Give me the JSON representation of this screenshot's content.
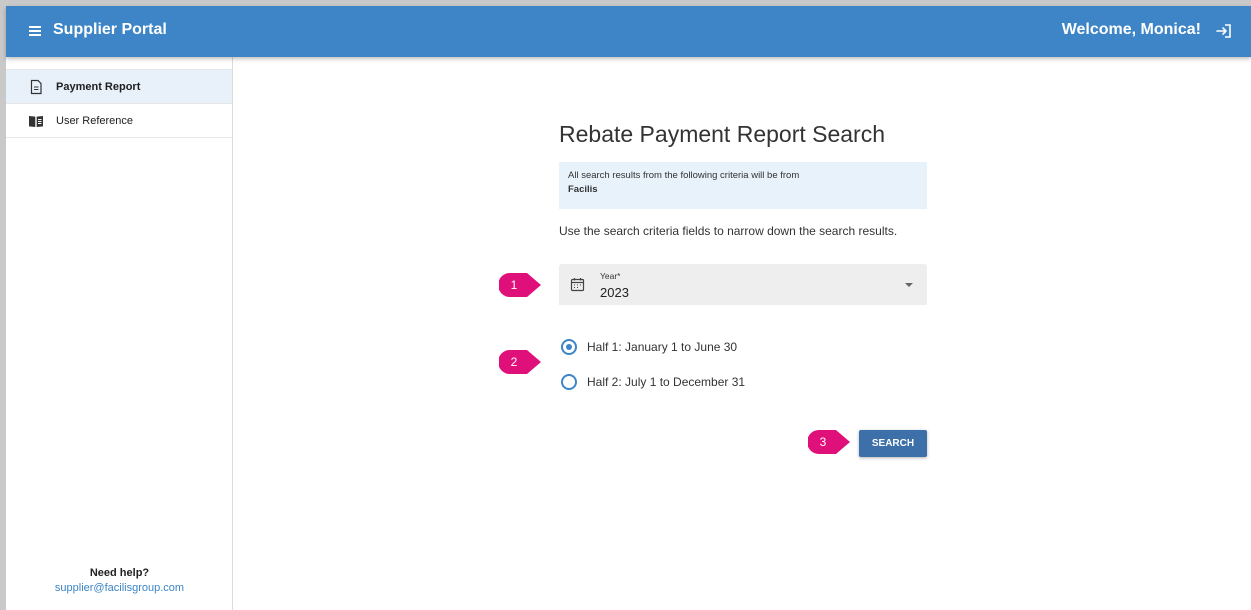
{
  "app": {
    "title": "Supplier Portal",
    "welcome": "Welcome, Monica!"
  },
  "sidebar": {
    "items": [
      {
        "label": "Payment Report",
        "icon": "document-icon",
        "active": true
      },
      {
        "label": "User Reference",
        "icon": "book-icon",
        "active": false
      }
    ],
    "help_title": "Need help?",
    "help_email": "supplier@facilisgroup.com"
  },
  "main": {
    "title": "Rebate Payment Report Search",
    "info_text": "All search results from the following criteria will be from",
    "info_org": "Facilis",
    "hint": "Use the search criteria fields to narrow down the search results.",
    "year_label": "Year*",
    "year_value": "2023",
    "options": [
      {
        "label": "Half 1: January 1 to June 30",
        "selected": true
      },
      {
        "label": "Half 2: July 1 to December 31",
        "selected": false
      }
    ],
    "search_label": "SEARCH"
  },
  "callouts": [
    "1",
    "2",
    "3"
  ],
  "colors": {
    "primary": "#3d85c6",
    "button": "#3d6fa8",
    "callout": "#e0107a",
    "info_bg": "#e8f2fb"
  }
}
